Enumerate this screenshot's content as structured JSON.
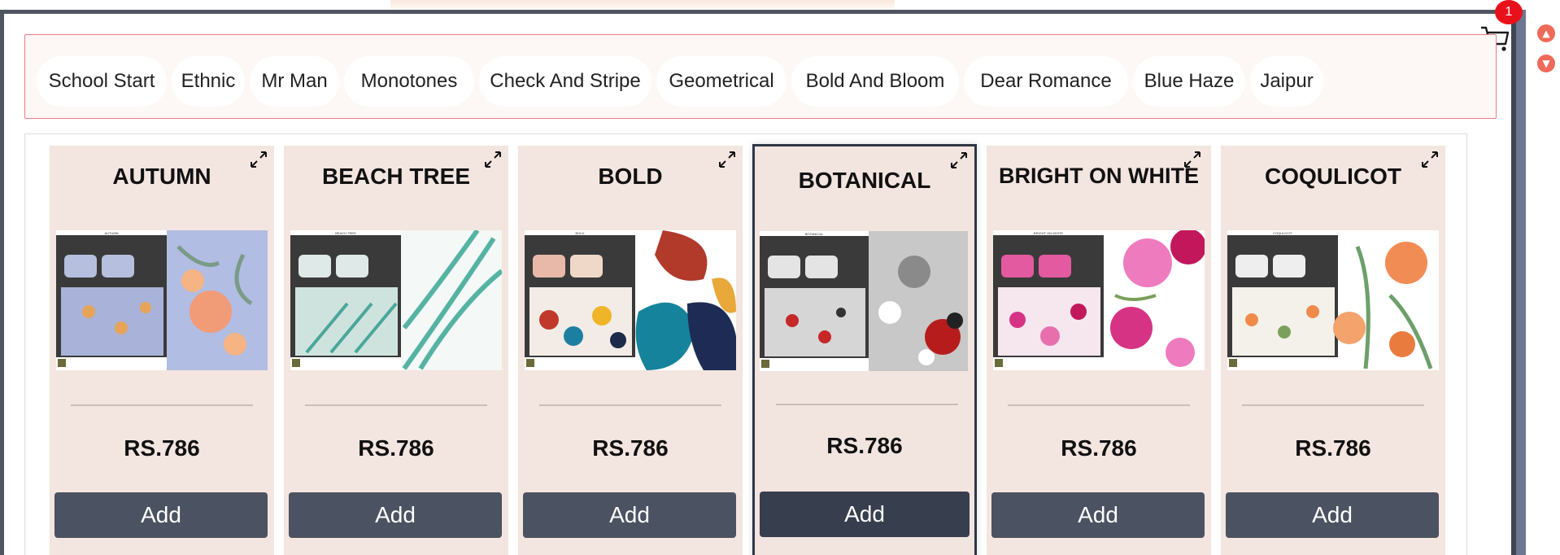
{
  "cart": {
    "count": "1",
    "icon": "cart-icon"
  },
  "scroll": {
    "up_icon": "scroll-up-icon",
    "down_icon": "scroll-down-icon"
  },
  "categories": [
    "School Start",
    "Ethnic",
    "Mr Man",
    "Monotones",
    "Check And Stripe",
    "Geometrical",
    "Bold And Bloom",
    "Dear Romance",
    "Blue Haze",
    "Jaipur"
  ],
  "products": [
    {
      "title": "AUTUMN",
      "price": "RS.786",
      "add_label": "Add",
      "image_caption": "AUTUMN"
    },
    {
      "title": "BEACH TREE",
      "price": "RS.786",
      "add_label": "Add",
      "image_caption": "BEACH TREE"
    },
    {
      "title": "BOLD",
      "price": "RS.786",
      "add_label": "Add",
      "image_caption": "BOLD"
    },
    {
      "title": "BOTANICAL",
      "price": "RS.786",
      "add_label": "Add",
      "image_caption": "BOTANICAL"
    },
    {
      "title": "BRIGHT ON WHITE",
      "price": "RS.786",
      "add_label": "Add",
      "image_caption": "BRIGHT ON WHITE"
    },
    {
      "title": "COQULICOT",
      "price": "RS.786",
      "add_label": "Add",
      "image_caption": "COQULICOT"
    }
  ],
  "colors": {
    "accent": "#4b5261",
    "card_bg": "#f3e5df",
    "badge": "#e8111b",
    "chip_border": "#ec7b86"
  }
}
